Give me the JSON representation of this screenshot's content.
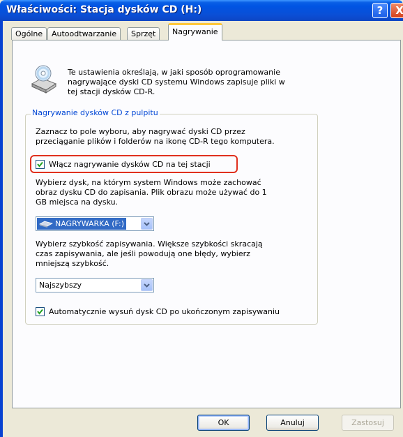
{
  "window": {
    "title": "Właściwości: Stacja dysków CD (H:)",
    "help_glyph": "?",
    "close_glyph": "X"
  },
  "tabs": [
    {
      "label": "Ogólne"
    },
    {
      "label": "Autoodtwarzanie"
    },
    {
      "label": "Sprzęt"
    },
    {
      "label": "Nagrywanie",
      "active": true
    }
  ],
  "intro": {
    "line1": "Te ustawienia określają, w jaki sposób oprogramowanie",
    "line2": "nagrywające dyski CD systemu Windows zapisuje pliki w",
    "line3": "tej stacji dysków CD-R.",
    "icon": "cd-drive-icon"
  },
  "group": {
    "title": "Nagrywanie dysków CD z pulpitu",
    "desc_line1": "Zaznacz to pole wyboru, aby nagrywać dyski CD przez",
    "desc_line2": "przeciąganie plików i folderów na ikonę CD-R tego komputera.",
    "enable_checkbox": {
      "label": "Włącz nagrywanie dysków CD na tej stacji",
      "checked": true
    },
    "drive_desc_line1": "Wybierz dysk, na którym system Windows może zachować",
    "drive_desc_line2": "obraz dysku CD do zapisania. Plik obrazu może używać do 1",
    "drive_desc_line3": "GB miejsca na dysku.",
    "drive_select": {
      "value": "NAGRYWARKA (F:)",
      "icon": "hard-drive-icon"
    },
    "speed_desc_line1": "Wybierz szybkość zapisywania. Większe szybkości skracają",
    "speed_desc_line2": "czas zapisywania, ale jeśli powodują one błędy, wybierz",
    "speed_desc_line3": "mniejszą szybkość.",
    "speed_select": {
      "value": "Najszybszy"
    },
    "eject_checkbox": {
      "label": "Automatycznie wysuń dysk CD po ukończonym zapisywaniu",
      "checked": true
    }
  },
  "buttons": {
    "ok": "OK",
    "cancel": "Anuluj",
    "apply": "Zastosuj"
  },
  "colors": {
    "title_bar": "#0054e3",
    "group_title": "#0046d5",
    "highlight_border": "#e0301e",
    "selection": "#316ac5",
    "checkmark": "#21a121"
  }
}
